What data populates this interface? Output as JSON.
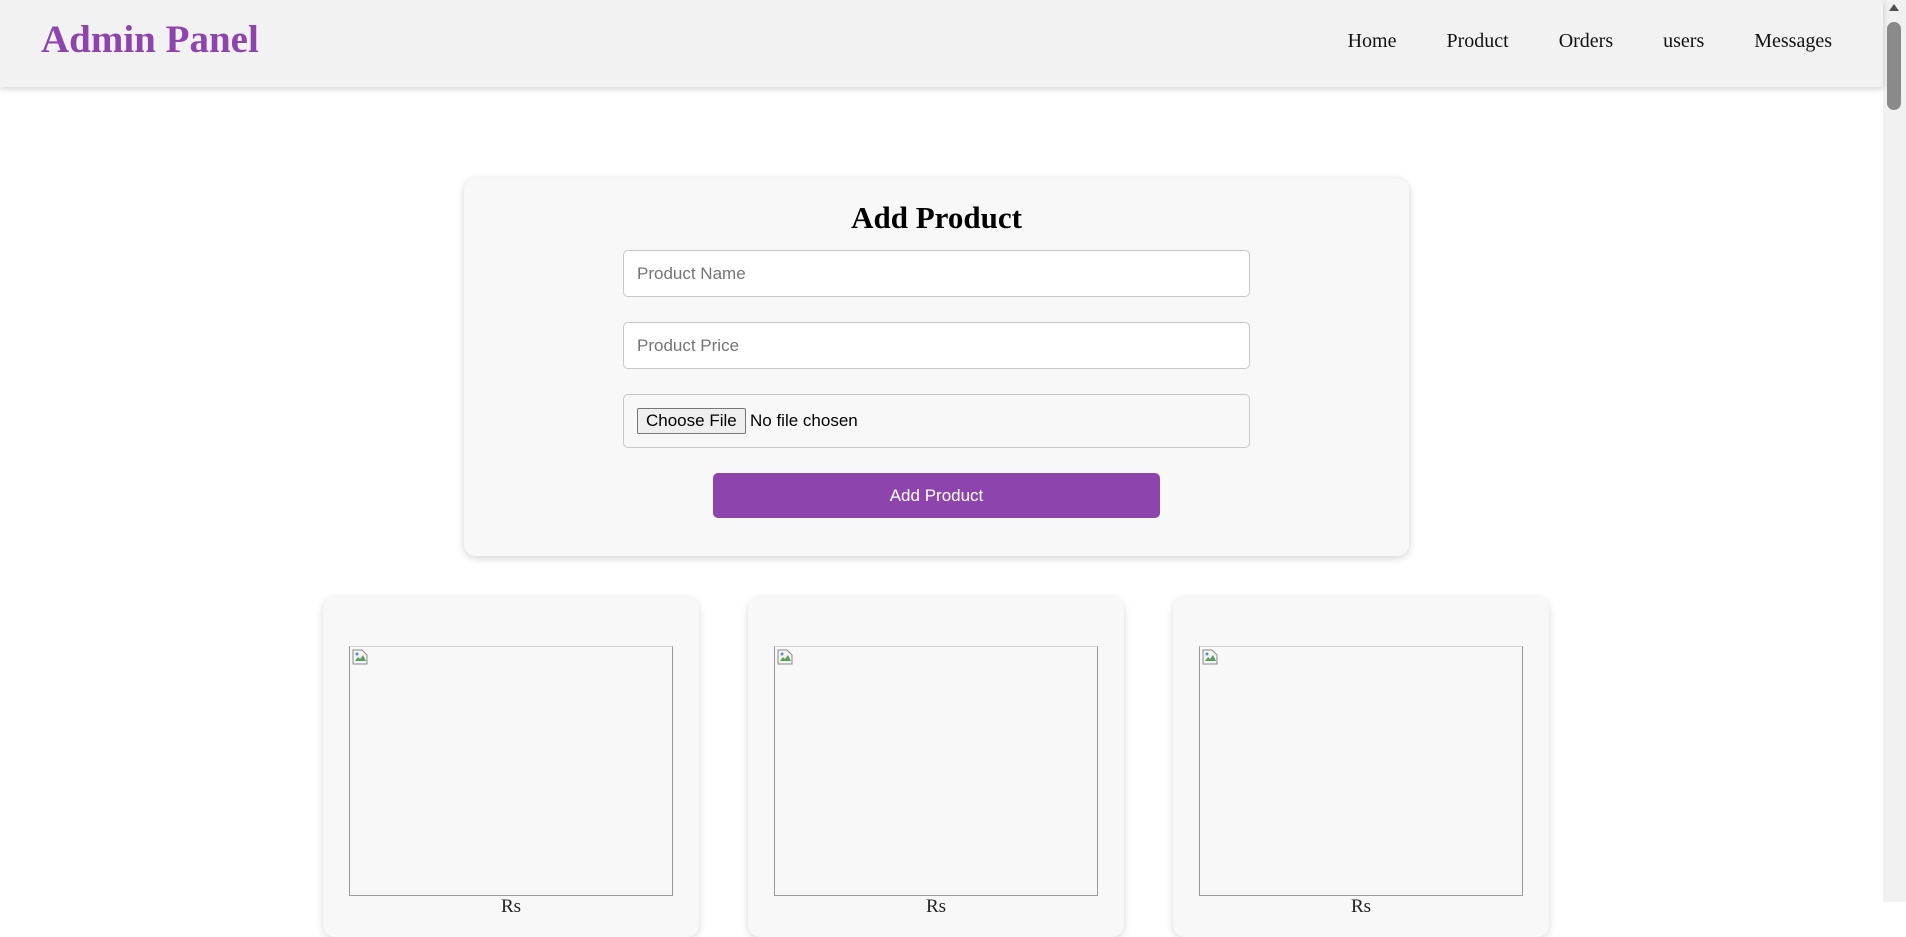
{
  "header": {
    "logo": "Admin Panel",
    "nav": [
      "Home",
      "Product",
      "Orders",
      "users",
      "Messages"
    ]
  },
  "form": {
    "title": "Add Product",
    "name_placeholder": "Product Name",
    "price_placeholder": "Product Price",
    "file_button": "Choose File",
    "file_status": "No file chosen",
    "submit_label": "Add Product"
  },
  "products": [
    {
      "caption": "Rs"
    },
    {
      "caption": "Rs"
    },
    {
      "caption": "Rs"
    }
  ],
  "colors": {
    "accent": "#8e44ad",
    "header_bg": "#f2f2f2",
    "card_bg": "#f8f8f8"
  },
  "icons": {
    "broken_image": "broken-image-icon"
  }
}
